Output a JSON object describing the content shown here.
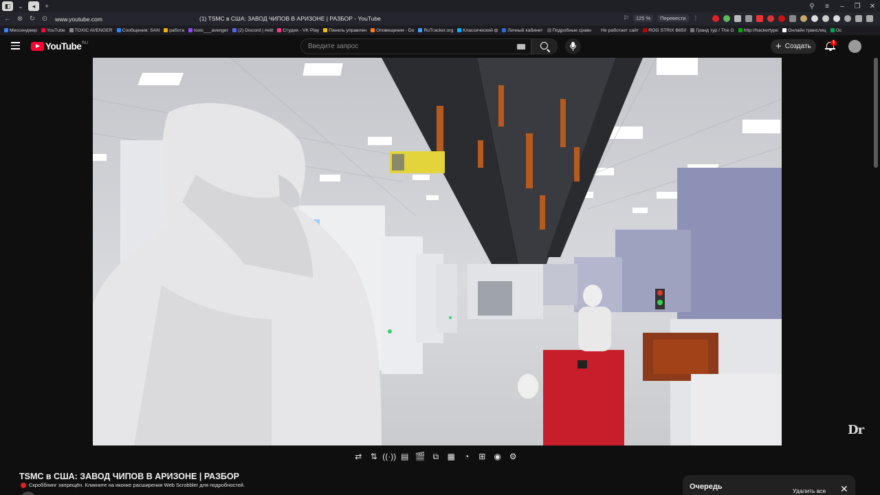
{
  "browser": {
    "url": "www.youtube.com",
    "tab_title": "(1) TSMC в США: ЗАВОД ЧИПОВ В АРИЗОНЕ | РАЗБОР - YouTube",
    "zoom": "125 %",
    "translate": "Перевести",
    "bookmarks": [
      {
        "label": "Мессенджер",
        "color": "#3b82f6"
      },
      {
        "label": "YouTube",
        "color": "#ff0033"
      },
      {
        "label": "TOXIC AVENGER",
        "color": "#888888"
      },
      {
        "label": "Сообщения: SAN",
        "color": "#2787f5"
      },
      {
        "label": "работа",
        "color": "#f0b400"
      },
      {
        "label": "toxic___avenger",
        "color": "#9146ff"
      },
      {
        "label": "(2) Discord | #elit",
        "color": "#5865f2"
      },
      {
        "label": "Студия - VK Play",
        "color": "#ff3985"
      },
      {
        "label": "Панель управлен",
        "color": "#f2c200"
      },
      {
        "label": "Оповещения - Do",
        "color": "#ff7a00"
      },
      {
        "label": "RuTracker.org",
        "color": "#3aa0ff"
      },
      {
        "label": "Классический ф",
        "color": "#00b2ff"
      },
      {
        "label": "Личный кабинет",
        "color": "#2e6bd6"
      },
      {
        "label": "Подробные сравн",
        "color": "#555555"
      },
      {
        "label": "Не работает сайт",
        "color": "#1e1e1e"
      },
      {
        "label": "ROG STRIX B650",
        "color": "#c00000"
      },
      {
        "label": "Гранд тур / The G",
        "color": "#777777"
      },
      {
        "label": "http://hackertype",
        "color": "#0a0"
      },
      {
        "label": "Онлайн трансляц",
        "color": "#ffffff"
      },
      {
        "label": "Ос",
        "color": "#00aa55"
      }
    ]
  },
  "header": {
    "logo_text": "YouTube",
    "region": "RU",
    "search_placeholder": "Введите запрос",
    "create_label": "Создать",
    "notifications_count": "1"
  },
  "player": {
    "watermark": "Dr"
  },
  "toolbar": {
    "icons": [
      "loop-icon",
      "sort-icon",
      "broadcast-icon",
      "playlist-icon",
      "clapper-icon",
      "frame-icon",
      "subtitles-icon",
      "speed-icon",
      "skip-icon",
      "screenshot-icon",
      "settings-icon"
    ],
    "glyphs": [
      "⇄",
      "⇅",
      "((·))",
      "▤",
      "🎬",
      "⧉",
      "▦",
      "◔",
      "⊞",
      "◉",
      "⚙"
    ]
  },
  "video": {
    "title": "TSMC в США: ЗАВОД ЧИПОВ В АРИЗОНЕ | РАЗБОР",
    "scrobbler_notice": "Скробблинг запрещён. Кликните на иконке расширения Web Scrobbler для подробностей."
  },
  "queue": {
    "title": "Очередь",
    "clear_label": "Удалить все"
  }
}
